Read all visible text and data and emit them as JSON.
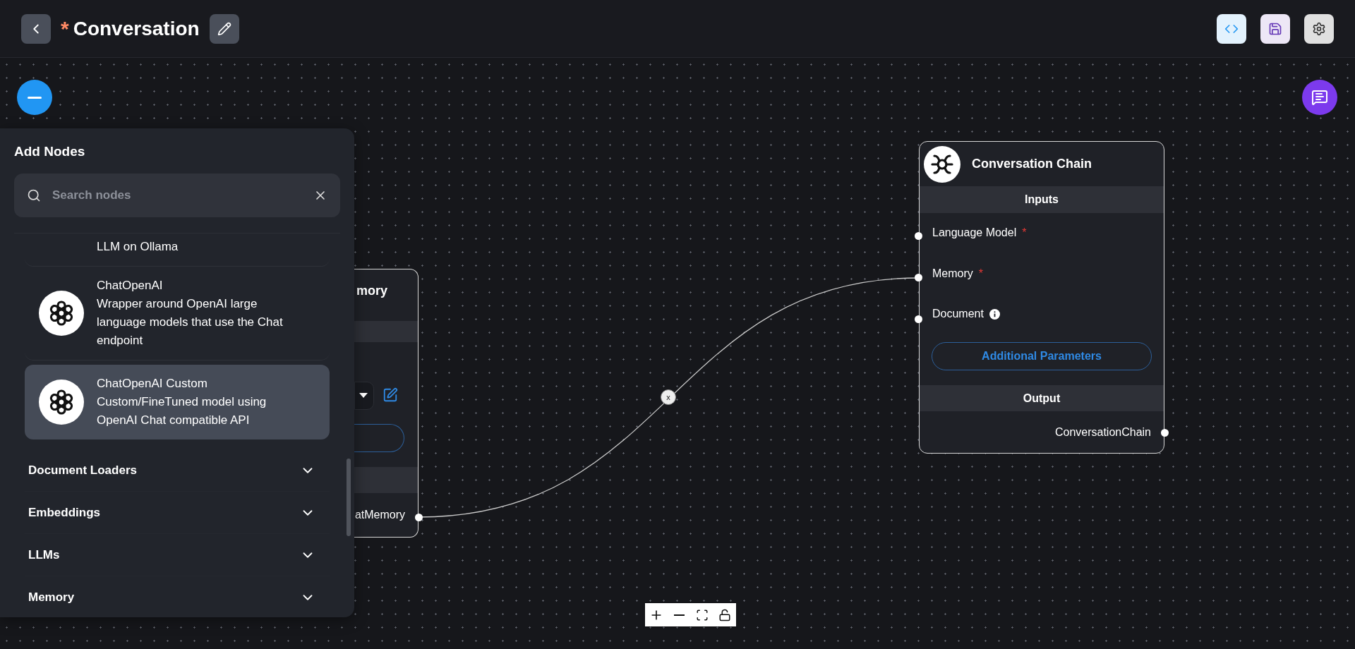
{
  "header": {
    "unsaved_mark": "*",
    "title": "Conversation"
  },
  "add_nodes": {
    "title": "Add Nodes",
    "search": {
      "placeholder": "Search nodes"
    },
    "items": [
      {
        "description": "LLM on Ollama",
        "selected": false
      },
      {
        "name": "ChatOpenAI",
        "description": "Wrapper around OpenAI large language models that use the Chat endpoint",
        "selected": false
      },
      {
        "name": "ChatOpenAI Custom",
        "description": "Custom/FineTuned model using OpenAI Chat compatible API",
        "selected": true
      }
    ],
    "categories": [
      {
        "label": "Document Loaders",
        "expanded": false
      },
      {
        "label": "Embeddings",
        "expanded": false
      },
      {
        "label": "LLMs",
        "expanded": false
      },
      {
        "label": "Memory",
        "expanded": false
      }
    ]
  },
  "memory_node": {
    "title": "mory",
    "output": "atMemory"
  },
  "chain_node": {
    "title": "Conversation Chain",
    "inputs_label": "Inputs",
    "required_mark": "*",
    "inputs": [
      {
        "label": "Language Model",
        "required": true,
        "info": false
      },
      {
        "label": "Memory",
        "required": true,
        "info": false
      },
      {
        "label": "Document",
        "required": false,
        "info": true
      }
    ],
    "additional_button": "Additional Parameters",
    "output_label": "Output",
    "output": "ConversationChain"
  },
  "edge": {
    "delete_label": "x"
  }
}
